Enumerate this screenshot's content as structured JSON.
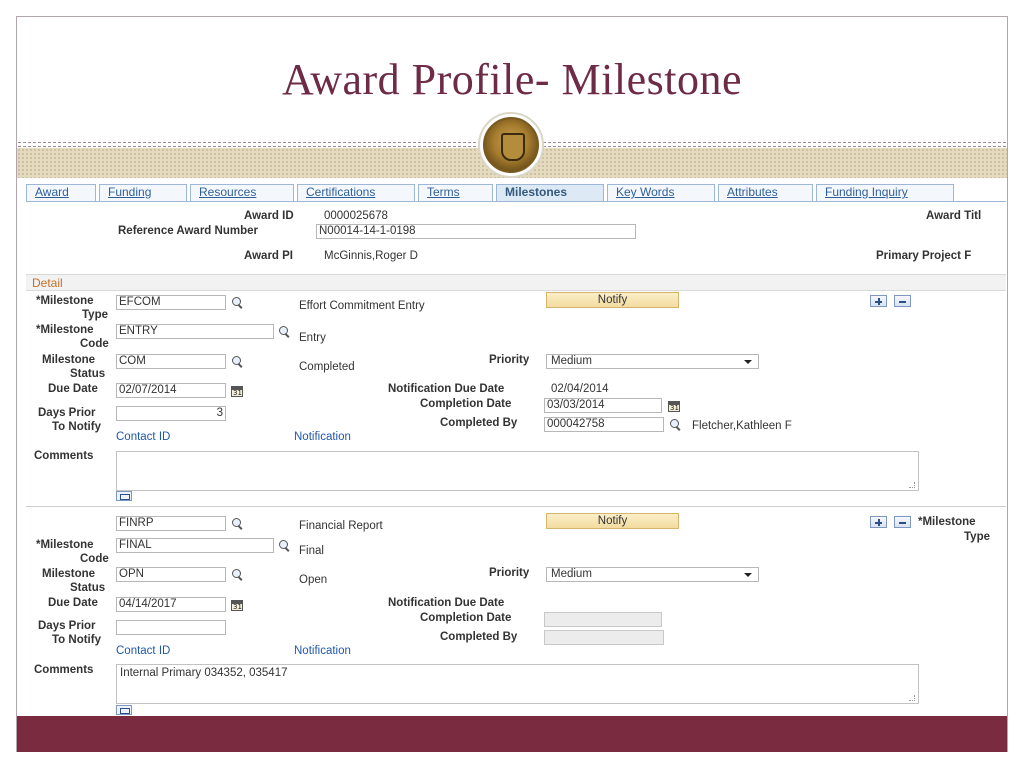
{
  "slide": {
    "title": "Award Profile- Milestone"
  },
  "tabs": [
    {
      "label": "Award",
      "active": false
    },
    {
      "label": "Funding",
      "active": false
    },
    {
      "label": "Resources",
      "active": false
    },
    {
      "label": "Certifications",
      "active": false
    },
    {
      "label": "Terms",
      "active": false
    },
    {
      "label": "Milestones",
      "active": true
    },
    {
      "label": "Key Words",
      "active": false
    },
    {
      "label": "Attributes",
      "active": false
    },
    {
      "label": "Funding Inquiry",
      "active": false
    }
  ],
  "header": {
    "award_id_label": "Award ID",
    "award_id": "0000025678",
    "ref_award_label": "Reference Award Number",
    "ref_award": "N00014-14-1-0198",
    "award_title_label": "Award Titl",
    "award_pi_label": "Award PI",
    "award_pi": "McGinnis,Roger D",
    "primary_project_label": "Primary Project F"
  },
  "detail": {
    "section_label": "Detail"
  },
  "labels": {
    "milestone_type": "*Milestone",
    "milestone_type_2": "Type",
    "milestone_code": "*Milestone",
    "milestone_code_2": "Code",
    "milestone_status": "Milestone",
    "milestone_status_2": "Status",
    "due_date": "Due Date",
    "days_prior": "Days Prior",
    "days_prior_2": "To Notify",
    "comments": "Comments",
    "priority": "Priority",
    "notification_due_date": "Notification Due Date",
    "completion_date": "Completion Date",
    "completed_by": "Completed By",
    "contact_id": "Contact ID",
    "notification": "Notification",
    "notify_button": "Notify"
  },
  "milestones": [
    {
      "type_code": "EFCOM",
      "type_desc": "Effort Commitment Entry",
      "code": "ENTRY",
      "code_desc": "Entry",
      "status": "COM",
      "status_desc": "Completed",
      "due_date": "02/07/2014",
      "days_prior": "3",
      "priority": "Medium",
      "notification_due_date": "02/04/2014",
      "completion_date": "03/03/2014",
      "completed_by": "000042758",
      "completed_by_name": "Fletcher,Kathleen F",
      "comments": ""
    },
    {
      "type_code": "FINRP",
      "type_desc": "Financial Report",
      "code": "FINAL",
      "code_desc": "Final",
      "status": "OPN",
      "status_desc": "Open",
      "due_date": "04/14/2017",
      "days_prior": "",
      "priority": "Medium",
      "notification_due_date": "",
      "completion_date": "",
      "completed_by": "",
      "completed_by_name": "",
      "comments": "Internal Primary 034352, 035417"
    }
  ]
}
